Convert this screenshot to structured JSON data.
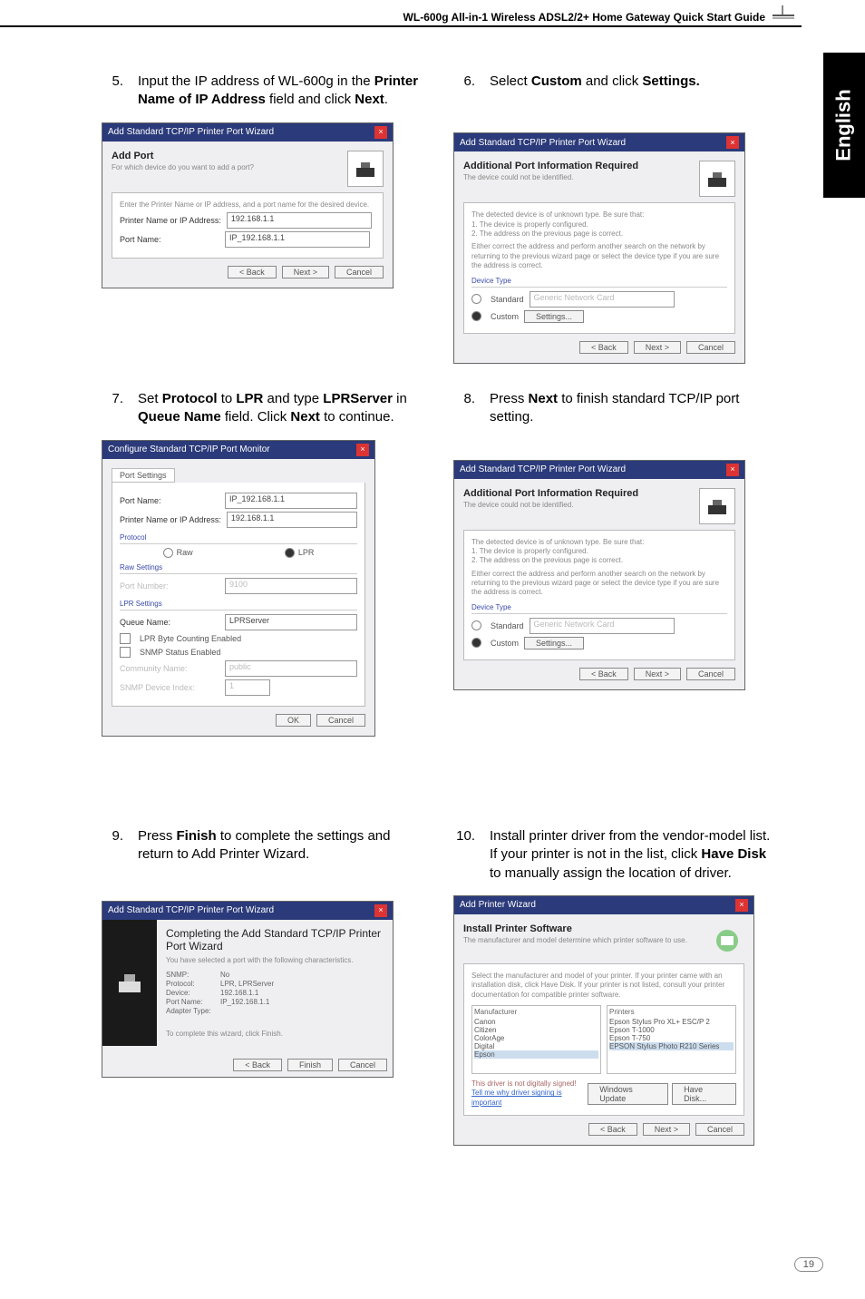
{
  "header": {
    "title": "WL-600g All-in-1 Wireless ADSL2/2+ Home Gateway Quick Start Guide"
  },
  "sidebar": {
    "lang": "English"
  },
  "steps": {
    "s5": {
      "n": "5.",
      "t1": "Input the IP address of WL-600g in the ",
      "b1": "Printer Name of IP Address",
      "t2": " field and click ",
      "b2": "Next",
      "t3": "."
    },
    "s6": {
      "n": "6.",
      "t1": "Select ",
      "b1": "Custom",
      "t2": " and click ",
      "b2": "Settings."
    },
    "s7": {
      "n": "7.",
      "t1": "Set ",
      "b1": "Protocol",
      "t2": " to ",
      "b2": "LPR",
      "t3": " and type ",
      "b3": "LPRServer",
      "t4": " in ",
      "b4": "Queue Name",
      "t5": " field. Click ",
      "b5": "Next",
      "t6": " to continue."
    },
    "s8": {
      "n": "8.",
      "t1": "Press ",
      "b1": "Next",
      "t2": " to finish standard TCP/IP port setting."
    },
    "s9": {
      "n": "9.",
      "t1": "Press ",
      "b1": "Finish",
      "t2": " to complete the settings and return to Add Printer Wizard."
    },
    "s10": {
      "n": "10.",
      "t1": "Install printer driver from the vendor-model list. If your printer is not in the list, click ",
      "b1": "Have Disk",
      "t2": " to manually assign the location of driver."
    }
  },
  "shot5": {
    "title": "Add Standard TCP/IP Printer Port Wizard",
    "h1": "Add Port",
    "h2": "For which device do you want to add a port?",
    "desc": "Enter the Printer Name or IP address, and a port name for the desired device.",
    "lbl1": "Printer Name or IP Address:",
    "val1": "192.168.1.1",
    "lbl2": "Port Name:",
    "val2": "IP_192.168.1.1",
    "back": "< Back",
    "next": "Next >",
    "cancel": "Cancel"
  },
  "shot6": {
    "title": "Add Standard TCP/IP Printer Port Wizard",
    "h1": "Additional Port Information Required",
    "h2": "The device could not be identified.",
    "l1": "The detected device is of unknown type. Be sure that:",
    "l2": "1. The device is properly configured.",
    "l3": "2. The address on the previous page is correct.",
    "l4": "Either correct the address and perform another search on the network by returning to the previous wizard page or select the device type if you are sure the address is correct.",
    "dtype": "Device Type",
    "std": "Standard",
    "stdv": "Generic Network Card",
    "cust": "Custom",
    "set": "Settings...",
    "back": "< Back",
    "next": "Next >",
    "cancel": "Cancel"
  },
  "shot7": {
    "title": "Configure Standard TCP/IP Port Monitor",
    "tab": "Port Settings",
    "pn": "Port Name:",
    "pnv": "IP_192.168.1.1",
    "pa": "Printer Name or IP Address:",
    "pav": "192.168.1.1",
    "prot": "Protocol",
    "raw": "Raw",
    "lpr": "LPR",
    "rawset": "Raw Settings",
    "rport": "Port Number:",
    "rportv": "9100",
    "lprset": "LPR Settings",
    "qn": "Queue Name:",
    "qnv": "LPRServer",
    "lprcb": "LPR Byte Counting Enabled",
    "snmp": "SNMP Status Enabled",
    "comm": "Community Name:",
    "commv": "public",
    "idx": "SNMP Device Index:",
    "idxv": "1",
    "ok": "OK",
    "cancel": "Cancel"
  },
  "shot8": {
    "title": "Add Standard TCP/IP Printer Port Wizard",
    "h1": "Additional Port Information Required",
    "h2": "The device could not be identified.",
    "l1": "The detected device is of unknown type. Be sure that:",
    "l2": "1. The device is properly configured.",
    "l3": "2. The address on the previous page is correct.",
    "l4": "Either correct the address and perform another search on the network by returning to the previous wizard page or select the device type if you are sure the address is correct.",
    "dtype": "Device Type",
    "std": "Standard",
    "stdv": "Generic Network Card",
    "cust": "Custom",
    "set": "Settings...",
    "back": "< Back",
    "next": "Next >",
    "cancel": "Cancel"
  },
  "shot9": {
    "title": "Add Standard TCP/IP Printer Port Wizard",
    "h1": "Completing the Add Standard TCP/IP Printer Port Wizard",
    "desc": "You have selected a port with the following characteristics.",
    "k1": "SNMP:",
    "v1": "No",
    "k2": "Protocol:",
    "v2": "LPR, LPRServer",
    "k3": "Device:",
    "v3": "192.168.1.1",
    "k4": "Port Name:",
    "v4": "IP_192.168.1.1",
    "k5": "Adapter Type:",
    "v5": "",
    "fin": "To complete this wizard, click Finish.",
    "back": "< Back",
    "finish": "Finish",
    "cancel": "Cancel"
  },
  "shot10": {
    "title": "Add Printer Wizard",
    "h1": "Install Printer Software",
    "h2": "The manufacturer and model determine which printer software to use.",
    "desc": "Select the manufacturer and model of your printer. If your printer came with an installation disk, click Have Disk. If your printer is not listed, consult your printer documentation for compatible printer software.",
    "mfg": "Manufacturer",
    "prn": "Printers",
    "m1": "Canon",
    "m2": "Citizen",
    "m3": "ColorAge",
    "m4": "Digital",
    "m5": "Epson",
    "p1": "Epson Stylus Pro XL+ ESC/P 2",
    "p2": "Epson T-1000",
    "p3": "Epson T-750",
    "p4": "EPSON Stylus Photo R210 Series",
    "signed": "This driver is not digitally signed!",
    "why": "Tell me why driver signing is important",
    "wu": "Windows Update",
    "hd": "Have Disk...",
    "back": "< Back",
    "next": "Next >",
    "cancel": "Cancel"
  },
  "footer": {
    "page": "19"
  }
}
